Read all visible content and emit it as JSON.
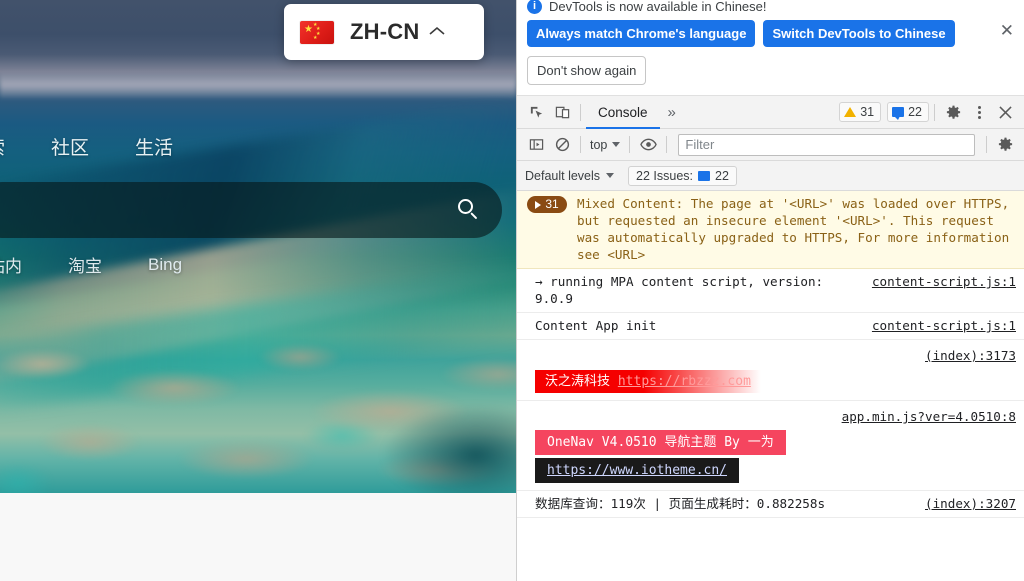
{
  "page": {
    "lang_widget": {
      "flag_icon": "flag-cn-icon",
      "label": "ZH-CN",
      "chevron": "︿"
    },
    "nav_primary": [
      {
        "label": "索"
      },
      {
        "label": "社区"
      },
      {
        "label": "生活"
      }
    ],
    "nav_secondary": [
      {
        "label": "站内"
      },
      {
        "label": "淘宝"
      },
      {
        "label": "Bing"
      }
    ],
    "search": {
      "value": "",
      "placeholder": "",
      "icon": "search-icon"
    }
  },
  "devtools": {
    "banner": {
      "info_icon": "i",
      "text": "DevTools is now available in Chinese!",
      "primary_button": "Always match Chrome's language",
      "secondary_button": "Switch DevTools to Chinese",
      "tertiary_button": "Don't show again",
      "close_icon": "✕"
    },
    "toolbar": {
      "inspect_icon": "inspect-element-icon",
      "device_icon": "device-toolbar-icon",
      "active_tab": "Console",
      "more_tabs": "»",
      "warning_count": "31",
      "message_count": "22",
      "settings_icon": "gear-icon",
      "kebab_icon": "more-options-icon",
      "close_icon": "✕"
    },
    "filterbar": {
      "sidebar_icon": "console-sidebar-icon",
      "clear_icon": "clear-console-icon",
      "context": "top",
      "eye_icon": "live-expression-icon",
      "filter_placeholder": "Filter",
      "filter_value": "",
      "settings_icon": "gear-icon"
    },
    "levelbar": {
      "levels": "Default levels",
      "issues_label": "22 Issues:",
      "issues_count": "22",
      "issues_icon": "issue-icon"
    },
    "console_messages": [
      {
        "type": "warning",
        "group_count": "31",
        "text": "Mixed Content: The page at '<URL>' was loaded over HTTPS, but requested an insecure element '<URL>'. This request was automatically upgraded to HTTPS, For more information see <URL>"
      },
      {
        "type": "log",
        "text": "→ running MPA content script, version: 9.0.9",
        "source": "content-script.js:1"
      },
      {
        "type": "log",
        "text": "Content App init",
        "source": "content-script.js:1"
      },
      {
        "type": "styled",
        "style": "red-gradient",
        "badge_text": "沃之涛科技",
        "link_text": "https://rbzzz.com",
        "source": "(index):3173"
      },
      {
        "type": "styled",
        "style": "pink-and-black",
        "badge_text": "OneNav V4.0510 导航主题 By 一为",
        "link_text": "https://www.iotheme.cn/",
        "source": "app.min.js?ver=4.0510:8"
      },
      {
        "type": "log",
        "text": "数据库查询：119次  |  页面生成耗时：0.882258s",
        "source": "(index):3207"
      }
    ]
  },
  "colors": {
    "accent_blue": "#1a73e8",
    "warning_bg": "#fffbe6",
    "warning_text": "#8a6116",
    "group_badge": "#8a4b13",
    "styled_red": "#f50000",
    "styled_pink": "#f5455f",
    "styled_black": "#1a1a1a"
  }
}
